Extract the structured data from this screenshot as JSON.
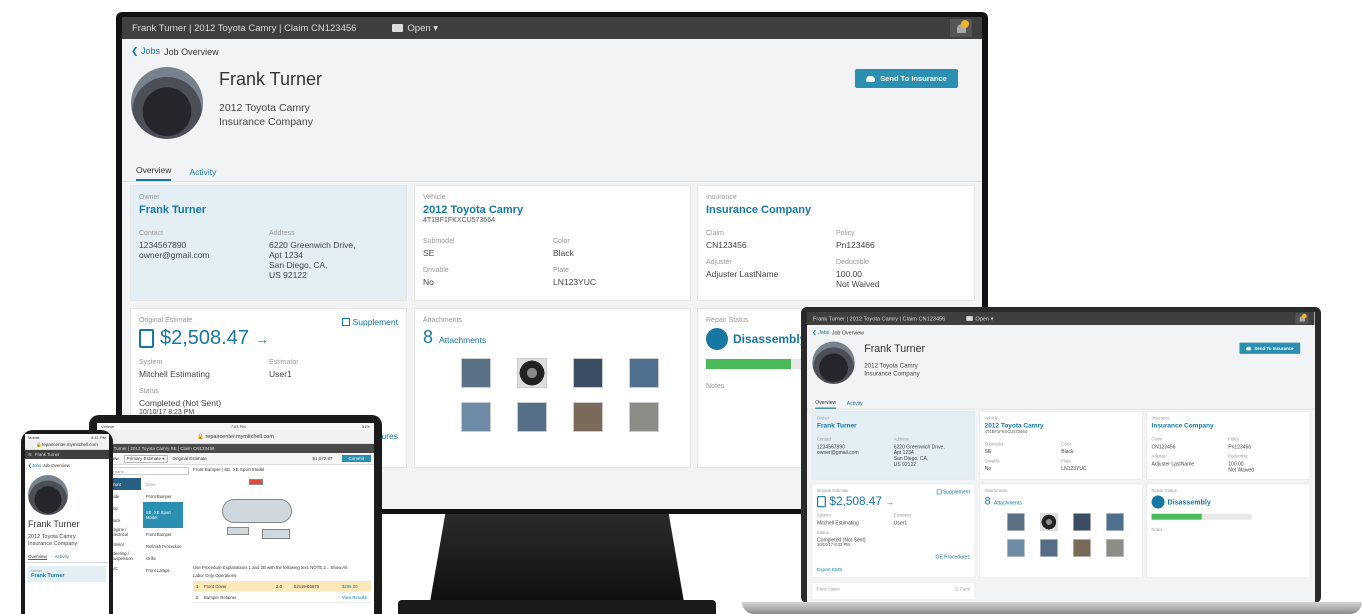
{
  "desktop": {
    "title_bar": "Frank Turner | 2012 Toyota Camry | Claim CN123456",
    "job_status": "Open ▾",
    "breadcrumb": {
      "back": "Jobs",
      "current": "Job Overview"
    },
    "customer": {
      "name": "Frank Turner",
      "vehicle": "2012 Toyota Camry",
      "insurer": "Insurance Company"
    },
    "send_button": "Send To Insurance",
    "tabs": [
      "Overview",
      "Activity"
    ],
    "owner": {
      "label": "Owner",
      "name": "Frank Turner",
      "contact_label": "Contact",
      "phone": "1234567890",
      "email": "owner@gmail.com",
      "address_label": "Address",
      "address": [
        "6220 Greenwich Drive,",
        "Apt 1234",
        "San Diego, CA,",
        "US 92122"
      ]
    },
    "vehicle": {
      "label": "Vehicle",
      "name": "2012 Toyota Camry",
      "vin": "4T1BF1FKXCU573664",
      "submodel_label": "Submodel",
      "submodel": "SE",
      "color_label": "Color",
      "color": "Black",
      "drivable_label": "Drivable",
      "drivable": "No",
      "plate_label": "Plate",
      "plate": "LN123YUC"
    },
    "insurance": {
      "label": "Insurance",
      "name": "Insurance Company",
      "claim_label": "Claim",
      "claim": "CN123456",
      "policy_label": "Policy",
      "policy": "Pn123466",
      "adjuster_label": "Adjuster",
      "adjuster": "Adjuster LastName",
      "deductible_label": "Deductible",
      "deductible": "100.00",
      "deductible_note": "Not Waived"
    },
    "estimate": {
      "label": "Original Estimate",
      "supplement": "Supplement",
      "amount": "$2,508.47",
      "arrow": "→",
      "system_label": "System",
      "system": "Mitchell Estimating",
      "estimator_label": "Estimator",
      "estimator": "User1",
      "status_label": "Status",
      "status": "Completed (Not Sent)",
      "date": "10/10/17 8:23 PM",
      "procedures": "dures"
    },
    "attachments": {
      "label": "Attachments",
      "count": "8",
      "count_label": "Attachments"
    },
    "repair": {
      "label": "Repair Status",
      "status": "Disassembly",
      "progress": 0.5,
      "notes_label": "Notes"
    }
  },
  "laptop": {
    "title_bar": "Frank Turner | 2012 Toyota Camry | Claim CN123456",
    "job_status": "Open ▾",
    "breadcrumb": {
      "back": "Jobs",
      "current": "Job Overview"
    },
    "customer": {
      "name": "Frank Turner",
      "vehicle": "2012 Toyota Camry",
      "insurer": "Insurance Company"
    },
    "send_button": "Send To Insurance",
    "tabs": [
      "Overview",
      "Activity"
    ],
    "owner": {
      "label": "Owner",
      "name": "Frank Turner",
      "contact_label": "Contact",
      "phone": "1234567890",
      "email": "owner@gmail.com",
      "address_label": "Address",
      "address": [
        "6220 Greenwich Drive,",
        "Apt 1234",
        "San Diego, CA,",
        "US 92122"
      ]
    },
    "vehicle": {
      "label": "Vehicle",
      "name": "2012 Toyota Camry",
      "vin": "4T1BF1FKXCU573664",
      "submodel_label": "Submodel",
      "submodel": "SE",
      "color_label": "Color",
      "color": "Black",
      "drivable_label": "Drivable",
      "drivable": "No",
      "plate_label": "Plate",
      "plate": "LN123YUC"
    },
    "insurance": {
      "label": "Insurance",
      "name": "Insurance Company",
      "claim_label": "Claim",
      "claim": "CN123456",
      "policy_label": "Policy",
      "policy": "Pn123466",
      "adjuster_label": "Adjuster",
      "adjuster": "Adjuster LastName",
      "deductible_label": "Deductible",
      "deductible": "100.00",
      "deductible_note": "Not Waived"
    },
    "estimate": {
      "label": "Original Estimate",
      "supplement": "Supplement",
      "amount": "$2,508.47",
      "arrow": "→",
      "system_label": "System",
      "system": "Mitchell Estimating",
      "estimator_label": "Estimator",
      "estimator": "User1",
      "status_label": "Status",
      "status": "Completed (Not Sent)",
      "date": "10/10/17 8:23 PM",
      "procedures": "OE Procedures",
      "export": "Export EMS"
    },
    "attachments": {
      "label": "Attachments",
      "count": "8",
      "count_label": "Attachments"
    },
    "repair": {
      "label": "Repair Status",
      "status": "Disassembly",
      "progress": 0.5,
      "notes_label": "Notes"
    },
    "parts": {
      "label": "Parts Status",
      "count": "11 Parts"
    }
  },
  "tablet": {
    "carrier": "Verizon",
    "time": "7:03 PM",
    "battery": "51%",
    "url": "repaircenter.mymitchell.com",
    "title_bar": "Frank Turner | 2012 Toyota Camry SE | Claim CN123456",
    "view_label": "Overview",
    "estimate_select": "Primary Estimate ▾",
    "original": "Original Estimate",
    "totals": "$1,072.87",
    "commit": "Commit",
    "search_placeholder": "Search parts...",
    "nav": [
      "Front",
      "Side",
      "Top",
      "Back",
      "Engine / Electrical",
      "Interior",
      "Steering / Suspension",
      "A/C"
    ],
    "zones_head": "Zone",
    "zones": [
      "Front Bumper",
      "SE, XE Sport Model",
      "Front Bumper",
      "Refinish Procedure",
      "Grille",
      "Front Lamps"
    ],
    "diagram_title": "Front Bumper | SE, XE Sport Model",
    "note": "Use Procedure Explanations 1 and 2B with the following text. NOTE 2...  Show All",
    "ops": "Labor Only Operations",
    "rows": [
      {
        "num": "1",
        "name": "Front Cover",
        "hours": "2.0",
        "part": "52119-06975",
        "price": "$295.00"
      },
      {
        "num": "2",
        "name": "Bumper Retainer",
        "hours": "",
        "part": "",
        "price": "View Results"
      }
    ]
  },
  "phone": {
    "carrier": "Mobile",
    "time": "8:41 PM",
    "url": "repaircenter.mymitchell.com",
    "title_bar": "Frank Turner",
    "breadcrumb": {
      "back": "Jobs",
      "current": "Job Overview"
    },
    "customer": {
      "name": "Frank Turner",
      "vehicle": "2012 Toyota Camry",
      "insurer": "Insurance Company"
    },
    "tabs": [
      "Overview",
      "Activity"
    ],
    "owner": {
      "label": "Owner",
      "name": "Frank Turner"
    }
  },
  "colors": {
    "accent": "#1677a3",
    "button": "#2a8fb0",
    "progress": "#4cba5a",
    "owner_card": "#e3eff4"
  }
}
